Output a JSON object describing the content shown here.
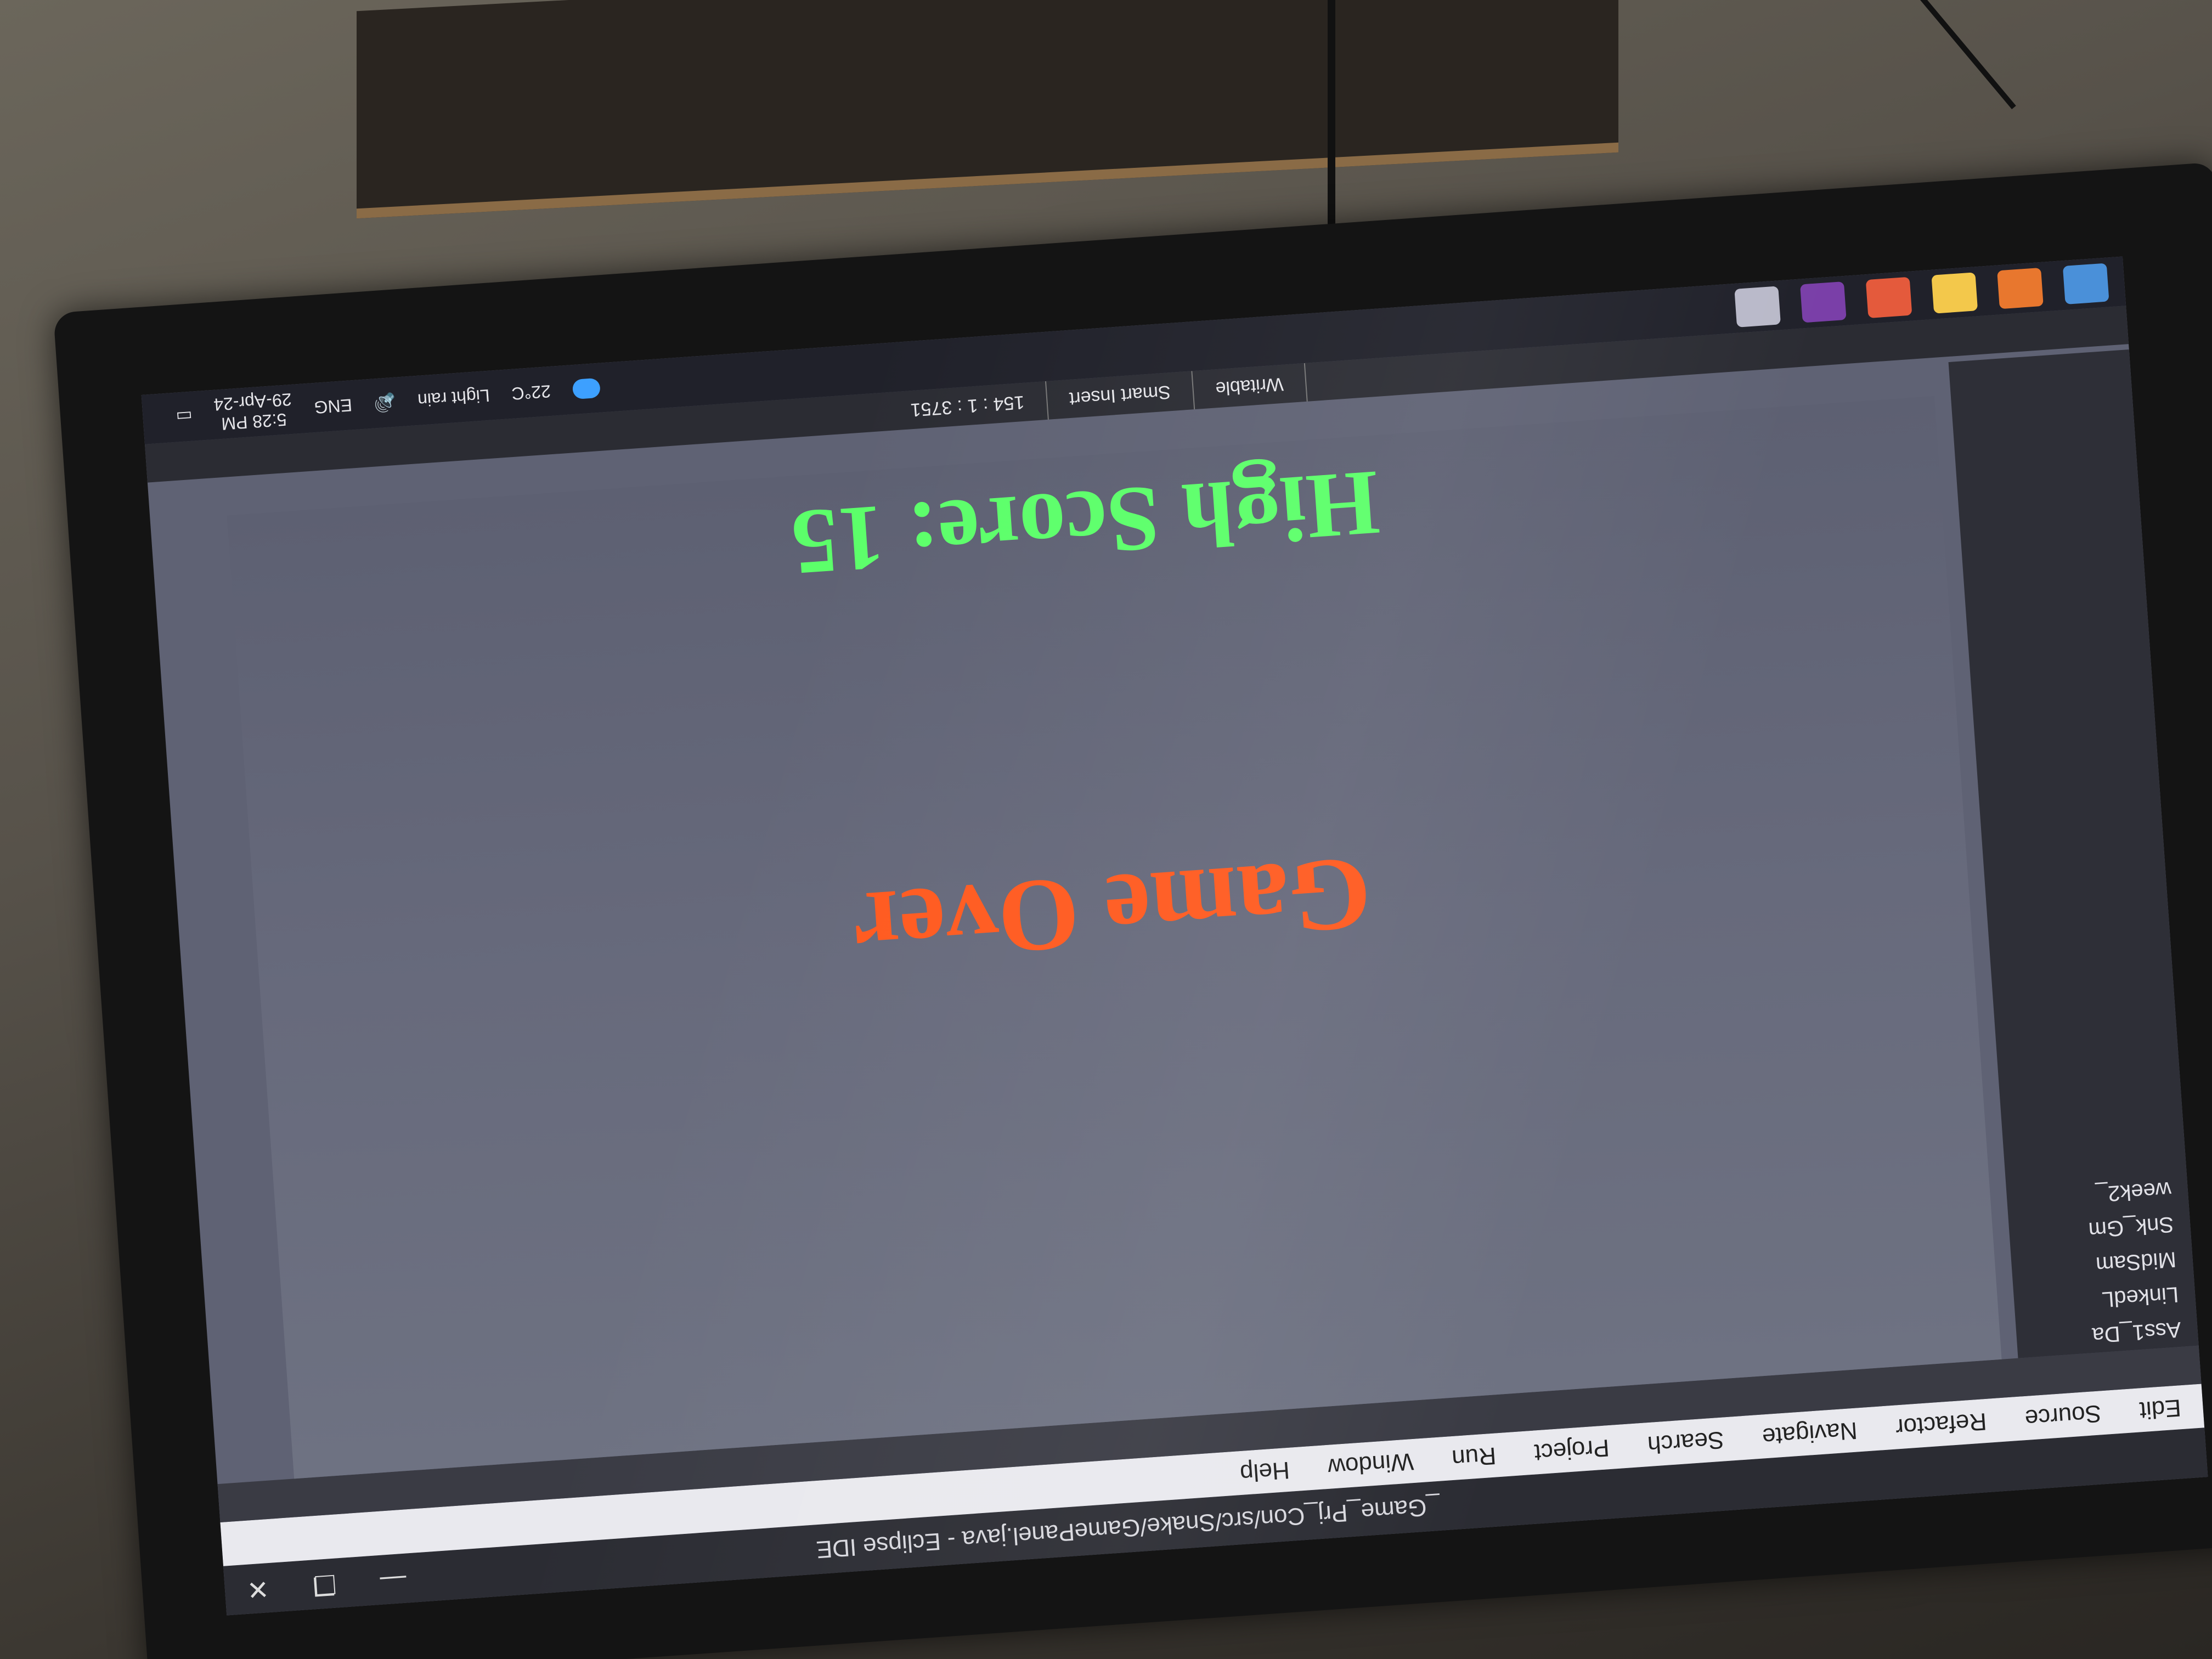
{
  "window": {
    "title": "_Game_Prj_Con/src/Snake/GamePanel.java - Eclipse IDE",
    "controls": [
      "—",
      "❐",
      "✕"
    ]
  },
  "menu": [
    "Edit",
    "Source",
    "Refactor",
    "Navigate",
    "Search",
    "Project",
    "Run",
    "Window",
    "Help"
  ],
  "project_explorer": [
    "Ass1_Da",
    "LinkedL",
    "MidSam",
    "Snk_Gm",
    "week2_"
  ],
  "game": {
    "message": "Game Over",
    "high_score_label": "High Score: 15"
  },
  "status_bar": {
    "mode": "Writable",
    "insert": "Smart Insert",
    "position": "154 : 1 : 3751"
  },
  "taskbar": {
    "weather_temp": "22°C",
    "weather_desc": "Light rain",
    "language": "ENG",
    "time": "5:28 PM",
    "date": "29-Apr-24"
  },
  "colors": {
    "game_over": "#ff5a1f",
    "high_score": "#5cff6a",
    "game_bg": "#686b7c"
  }
}
